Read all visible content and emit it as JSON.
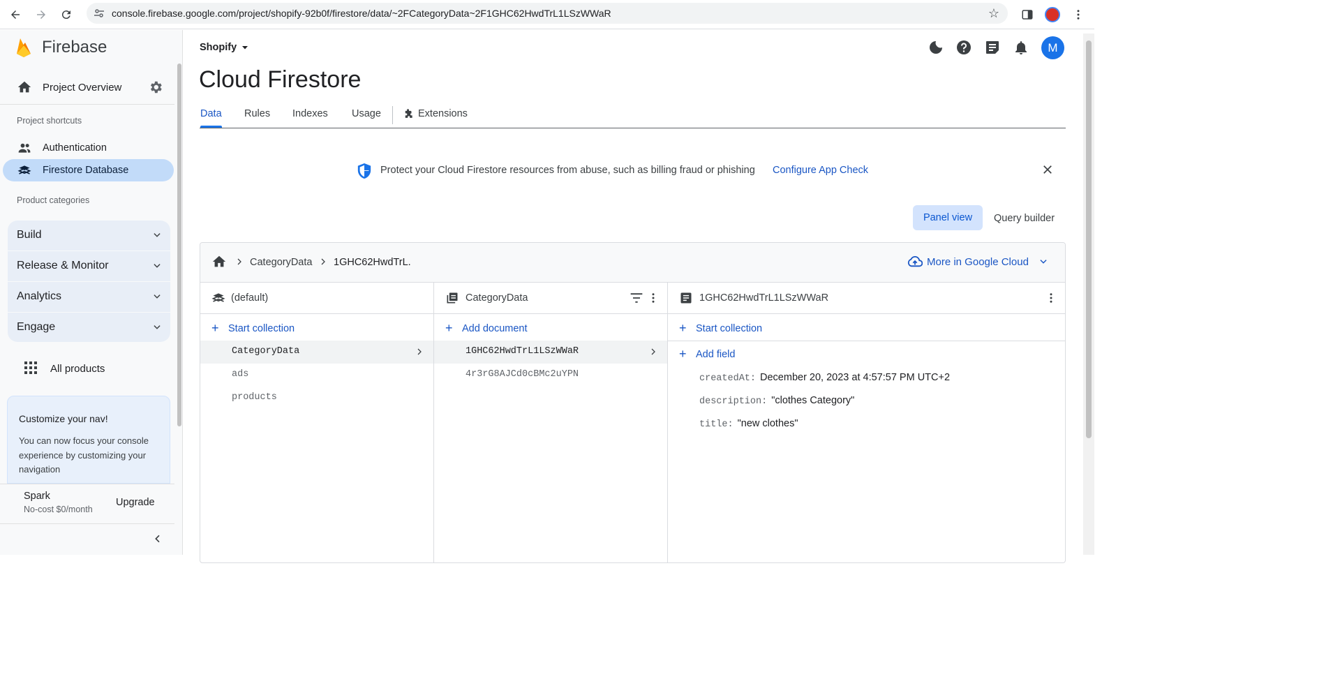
{
  "browser": {
    "url": "console.firebase.google.com/project/shopify-92b0f/firestore/data/~2FCategoryData~2F1GHC62HwdTrL1LSzWWaR"
  },
  "sidebar": {
    "brand": "Firebase",
    "project_overview": "Project Overview",
    "shortcuts_caption": "Project shortcuts",
    "shortcuts": [
      {
        "label": "Authentication",
        "icon": "people-icon"
      },
      {
        "label": "Firestore Database",
        "icon": "firestore-icon",
        "active": true
      }
    ],
    "categories_caption": "Product categories",
    "categories": [
      "Build",
      "Release & Monitor",
      "Analytics",
      "Engage"
    ],
    "all_products": "All products",
    "customize": {
      "title": "Customize your nav!",
      "body": "You can now focus your console experience by customizing your navigation"
    },
    "plan": {
      "name": "Spark",
      "sub": "No-cost $0/month",
      "upgrade": "Upgrade"
    }
  },
  "header": {
    "project": "Shopify",
    "title": "Cloud Firestore",
    "avatar_letter": "M",
    "tabs": [
      "Data",
      "Rules",
      "Indexes",
      "Usage",
      "Extensions"
    ],
    "active_tab": "Data"
  },
  "banner": {
    "text": "Protect your Cloud Firestore resources from abuse, such as billing fraud or phishing",
    "link": "Configure App Check"
  },
  "view_toggle": {
    "panel": "Panel view",
    "query": "Query builder"
  },
  "breadcrumb": {
    "items": [
      "CategoryData",
      "1GHC62HwdTrL."
    ],
    "more": "More in Google Cloud"
  },
  "columns": {
    "root": {
      "title": "(default)",
      "action": "Start collection",
      "items": [
        "CategoryData",
        "ads",
        "products"
      ]
    },
    "collection": {
      "title": "CategoryData",
      "action": "Add document",
      "items": [
        "1GHC62HwdTrL1LSzWWaR",
        "4r3rG8AJCd0cBMc2uYPN"
      ]
    },
    "document": {
      "title": "1GHC62HwdTrL1LSzWWaR",
      "action1": "Start collection",
      "action2": "Add field",
      "fields": [
        {
          "key": "createdAt:",
          "value": "December 20, 2023 at 4:57:57 PM UTC+2"
        },
        {
          "key": "description:",
          "value": "\"clothes Category\""
        },
        {
          "key": "title:",
          "value": "\"new clothes\""
        }
      ]
    }
  },
  "colors": {
    "accent": "#1a73e8",
    "active_nav": "#c2dbf9",
    "link": "#1a56c4"
  }
}
